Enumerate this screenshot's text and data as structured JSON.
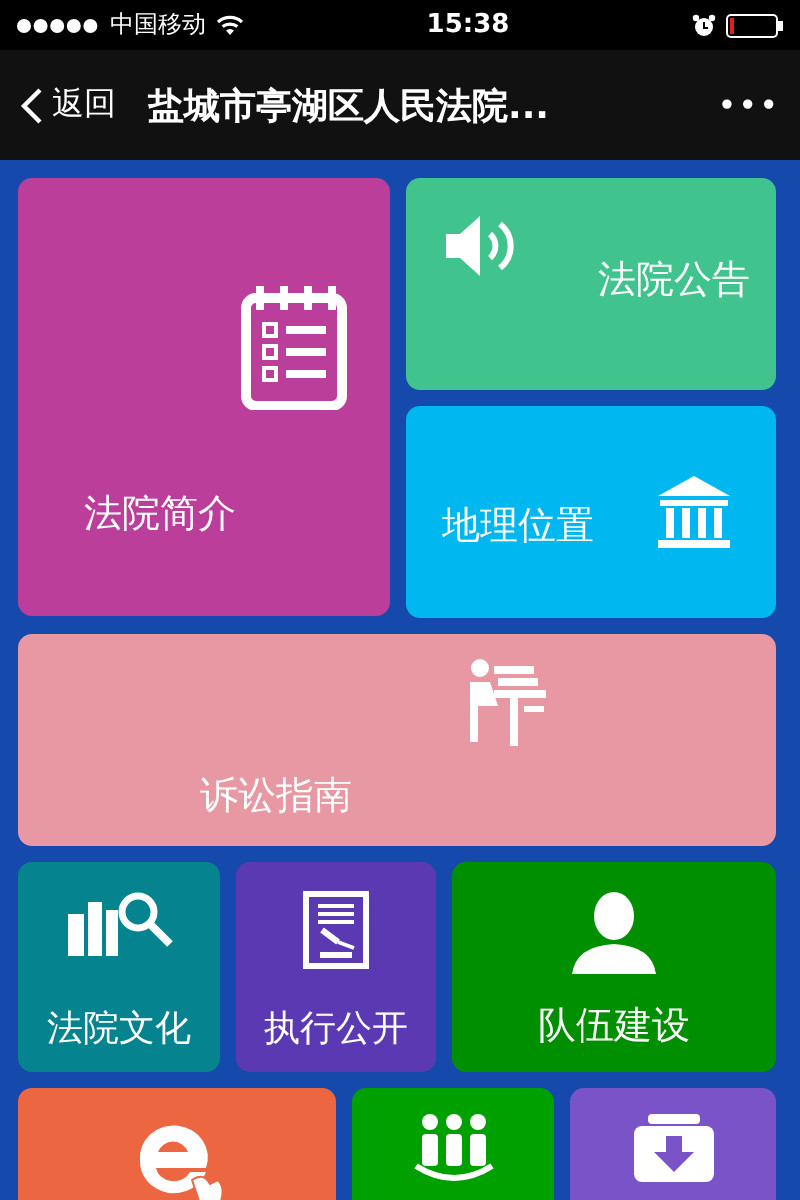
{
  "status_bar": {
    "carrier": "中国移动",
    "time": "15:38"
  },
  "nav": {
    "back": "返回",
    "title": "盐城市亭湖区人民法院...",
    "more": "•••"
  },
  "tiles": [
    {
      "kind": "notebook",
      "label": "法院简介",
      "color": "#bb3e9a"
    },
    {
      "kind": "speaker",
      "label": "法院公告",
      "color": "#41c38e"
    },
    {
      "kind": "building",
      "label": "地理位置",
      "color": "#00b7ef"
    },
    {
      "kind": "desk",
      "label": "诉讼指南",
      "color": "#e898a2"
    },
    {
      "kind": "books",
      "label": "法院文化",
      "color": "#05848f"
    },
    {
      "kind": "gavel",
      "label": "执行公开",
      "color": "#5b39b3"
    },
    {
      "kind": "person",
      "label": "队伍建设",
      "color": "#008f00"
    },
    {
      "kind": "e-touch",
      "color": "#ed6642"
    },
    {
      "kind": "group",
      "color": "#00a000"
    },
    {
      "kind": "download",
      "color": "#7a53c8"
    }
  ]
}
